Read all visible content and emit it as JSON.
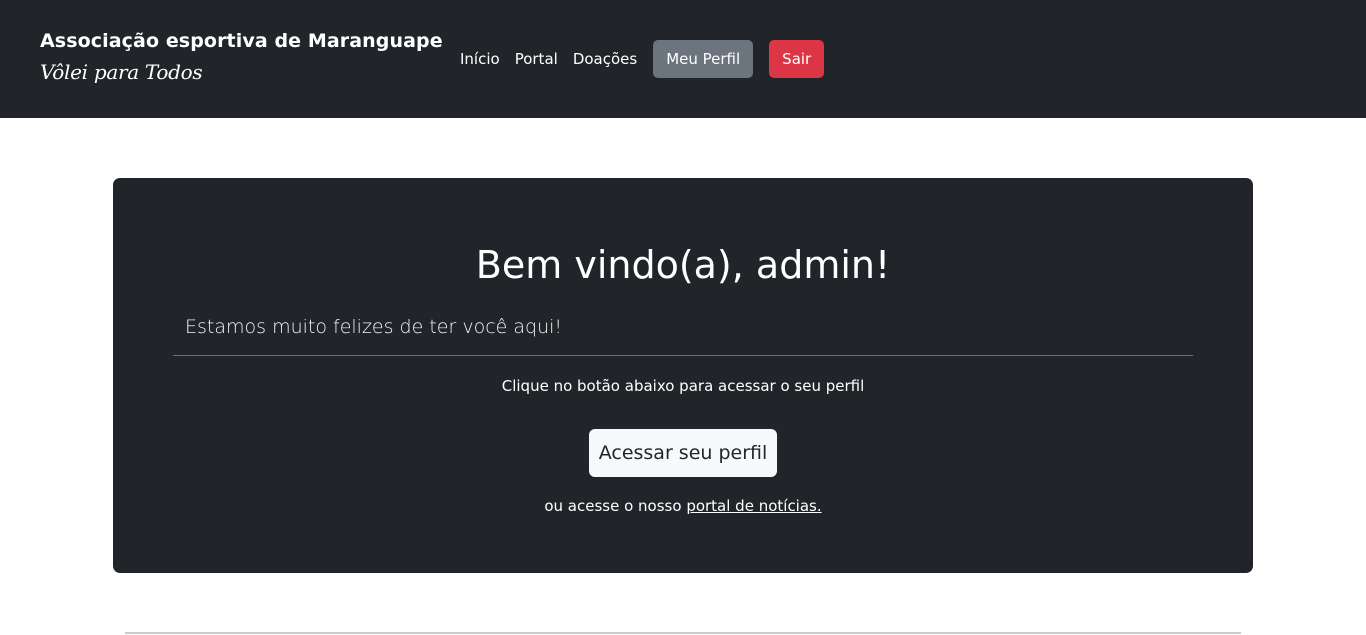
{
  "header": {
    "brand_title": "Associação esportiva de Maranguape",
    "brand_tagline": "Vôlei para Todos",
    "nav": {
      "home": "Início",
      "portal": "Portal",
      "donations": "Doações",
      "profile": "Meu Perfil",
      "logout": "Sair"
    }
  },
  "main": {
    "welcome": "Bem vindo(a), admin!",
    "lead": "Estamos muito felizes de ter você aqui!",
    "cta_text": "Clique no botão abaixo para acessar o seu perfil",
    "cta_button": "Acessar seu perfil",
    "alt_prefix": "ou acesse o nosso ",
    "alt_link": "portal de notícias."
  },
  "colors": {
    "navbar_bg": "#212529",
    "card_bg": "#212529",
    "profile_button": "#6c757d",
    "logout_button": "#dc3545",
    "cta_button": "#f8f9fa"
  }
}
